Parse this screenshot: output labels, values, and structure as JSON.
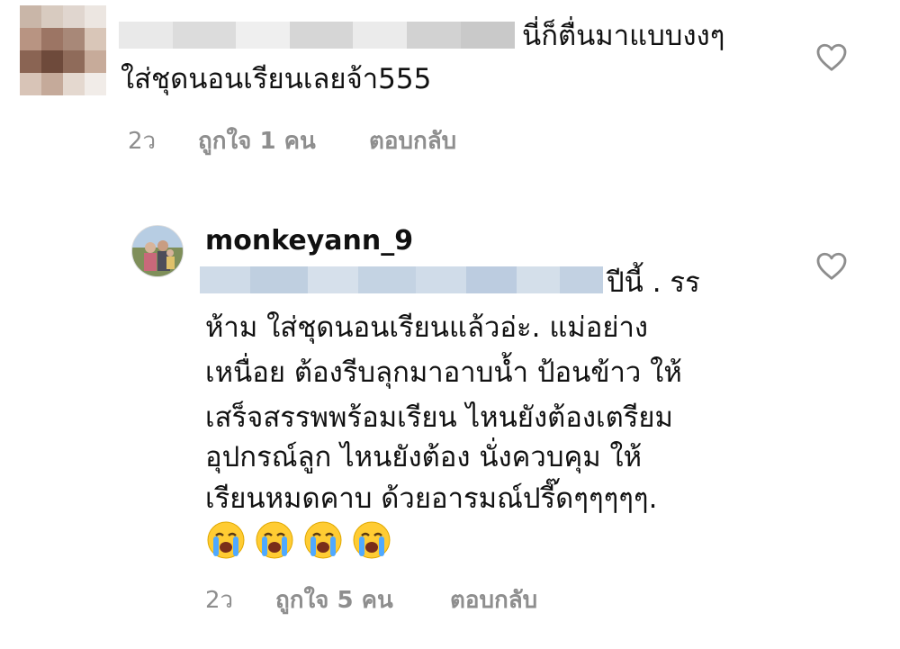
{
  "comments": [
    {
      "text_line1": "นี่ก็ตื่นมาแบบงงๆ",
      "text_line2": "ใส่ชุดนอนเรียนเลยจ้า555",
      "time": "2ว",
      "likes": "ถูกใจ 1 คน",
      "reply": "ตอบกลับ",
      "like_icon": "heart-outline-icon"
    },
    {
      "username": "monkeyann_9",
      "text_line1": "ปีนี้ . รร",
      "lines": [
        "ห้าม ใส่ชุดนอนเรียนแล้วอ่ะ. แม่อย่าง",
        "เหนื่อย ต้องรีบลุกมาอาบน้ำ ป้อนข้าว ให้",
        "เสร็จสรรพพร้อมเรียน ไหนยังต้องเตรียม",
        "อุปกรณ์ลูก ไหนยังต้อง นั่งควบคุม  ให้",
        "เรียนหมดคาบ ด้วยอารมณ์ปรี๊ดๆๆๆๆๆ."
      ],
      "emoji": [
        "crying-face",
        "crying-face",
        "crying-face",
        "crying-face"
      ],
      "time": "2ว",
      "likes": "ถูกใจ 5 คน",
      "reply": "ตอบกลับ",
      "like_icon": "heart-outline-icon"
    }
  ],
  "colors": {
    "meta": "#8e8e8e",
    "text": "#111111",
    "blur_blue": "#c9d6e6"
  }
}
